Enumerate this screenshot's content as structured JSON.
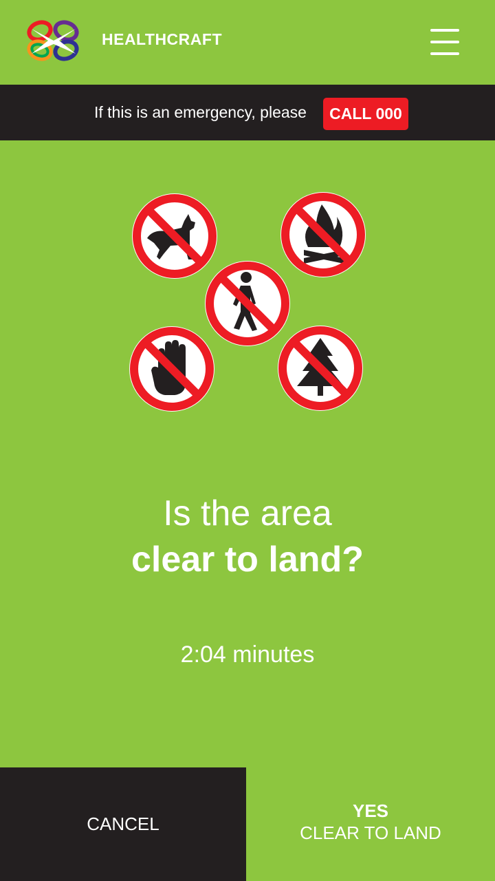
{
  "header": {
    "brand": "HEALTHCRAFT",
    "logo_icon": "healthcraft-logo-icon",
    "menu_icon": "hamburger-menu-icon"
  },
  "banner": {
    "text": "If this is an emergency, please",
    "call_label": "CALL 000"
  },
  "signs": [
    "no-dogs-icon",
    "no-fires-icon",
    "no-pedestrians-icon",
    "no-hands-icon",
    "no-trees-icon"
  ],
  "question": {
    "line1": "Is the area",
    "line2": "clear to land?"
  },
  "timer": "2:04 minutes",
  "actions": {
    "cancel_label": "CANCEL",
    "yes_label": "YES",
    "yes_sub": "CLEAR TO LAND"
  },
  "colors": {
    "background": "#8dc63f",
    "dark": "#231f20",
    "alert_red": "#ed1c24"
  }
}
